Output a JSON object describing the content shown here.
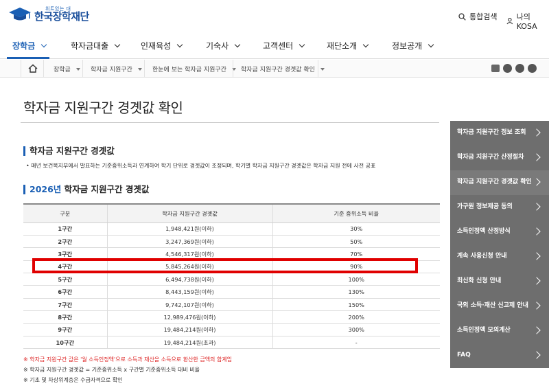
{
  "header": {
    "logo_sub": "위트있는 대",
    "logo_main": "한국장학재단",
    "search_label": "통합검색",
    "my_label": "나의 KOSA"
  },
  "gnb": {
    "items": [
      "장학금",
      "학자금대출",
      "인재육성",
      "기숙사",
      "고객센터",
      "재단소개",
      "정보공개"
    ]
  },
  "breadcrumb": {
    "items": [
      "장학금",
      "학자금 지원구간",
      "한눈에 보는 학자금 지원구간",
      "학자금 지원구간 경곗값 확인"
    ]
  },
  "page_title": "학자금 지원구간 경곗값 확인",
  "section1": {
    "title": "학자금 지원구간 경곗값",
    "bullet": "• 매년 보건복지부에서 발표하는 기준중위소득과 연계하여 학기 단위로 경곗값이 조정되며, 학기별 학자금 지원구간 경곗값은 학자금 지원 전에 사전 공표"
  },
  "section2": {
    "year": "2026년",
    "title_rest": " 학자금 지원구간 경곗값"
  },
  "table": {
    "headers": [
      "구분",
      "학자금 지원구간 경곗값",
      "기준 중위소득 비율"
    ],
    "rows": [
      [
        "1구간",
        "1,948,421원(이하)",
        "30%"
      ],
      [
        "2구간",
        "3,247,369원(이하)",
        "50%"
      ],
      [
        "3구간",
        "4,546,317원(이하)",
        "70%"
      ],
      [
        "4구간",
        "5,845,264원(이하)",
        "90%"
      ],
      [
        "5구간",
        "6,494,738원(이하)",
        "100%"
      ],
      [
        "6구간",
        "8,443,159원(이하)",
        "130%"
      ],
      [
        "7구간",
        "9,742,107원(이하)",
        "150%"
      ],
      [
        "8구간",
        "12,989,476원(이하)",
        "200%"
      ],
      [
        "9구간",
        "19,484,214원(이하)",
        "300%"
      ],
      [
        "10구간",
        "19,484,214원(초과)",
        "-"
      ]
    ]
  },
  "notes": {
    "n1": "※ 학자금 지원구간 값은 '월 소득인정액'으로 소득과 재산을 소득으로 환산한 금액의 합계임",
    "n2": "※ 학자금 지원구간 경곗값 = 기준중위소득 x 구간별 기준중위소득 대비 비율",
    "n3": "※ 기초 및 차상위계층은 수급자격으로 확인"
  },
  "side_menu": {
    "items": [
      "학자금 지원구간 정보 조회",
      "학자금 지원구간 산정절차",
      "학자금 지원구간 경곗값 확인",
      "가구원 정보제공 동의",
      "소득인정액 산정방식",
      "계속 사용신청 안내",
      "최신화 신청 안내",
      "국외 소득·재산 신고제 안내",
      "소득인정액 모의계산",
      "FAQ"
    ]
  },
  "colors": {
    "brand_blue": "#1a5fb4",
    "side_menu_bg": "#6e6e6e",
    "highlight_red": "#e00000"
  }
}
